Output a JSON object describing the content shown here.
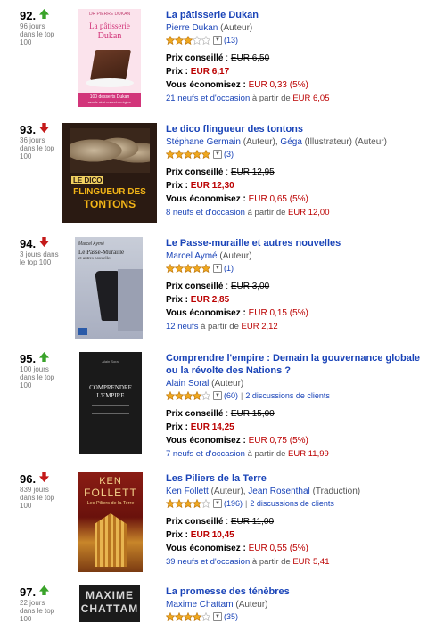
{
  "labels": {
    "list_price": "Prix conseillé",
    "price": "Prix :",
    "you_save": "Vous économisez :",
    "from": "à partir de"
  },
  "colors": {
    "link": "#1a44b8",
    "price": "#bb0000",
    "arrow_up": "#3aa32a",
    "arrow_down": "#c41a1a"
  },
  "items": [
    {
      "rank": "92.",
      "trend": "up",
      "days": "96 jours dans le top 100",
      "cover": {
        "text_top": "DR PIERRE DUKAN",
        "title_line1": "La pâtisserie",
        "title_line2": "Dukan",
        "footer_line1": "100 desserts Dukan",
        "footer_line2": "avec le strict respect du régime"
      },
      "title": "La pâtisserie Dukan",
      "authors": "Pierre Dukan",
      "roles": "(Auteur)",
      "rating_count": "(13)",
      "discussions": "",
      "stars": 3,
      "list_price": "EUR 6,50",
      "price": "EUR 6,17",
      "savings": "EUR 0,33 (5%)",
      "offers_count": "21 neufs et d'occasion",
      "offers_from": "EUR 6,05"
    },
    {
      "rank": "93.",
      "trend": "down",
      "days": "36 jours dans le top 100",
      "cover": {
        "text_top": "",
        "title_line1": "LE DICO",
        "title_line2": "FLINGUEUR DES",
        "title_line3": "TONTONS"
      },
      "title": "Le dico flingueur des tontons",
      "authors": "Stéphane Germain",
      "roles": "(Auteur),",
      "authors2": "Géga",
      "roles2": "(Illustrateur) (Auteur)",
      "rating_count": "(3)",
      "discussions": "",
      "stars": 5,
      "list_price": "EUR 12,95",
      "price": "EUR 12,30",
      "savings": "EUR 0,65 (5%)",
      "offers_count": "8 neufs et d'occasion",
      "offers_from": "EUR 12,00"
    },
    {
      "rank": "94.",
      "trend": "down",
      "days": "3 jours dans le top 100",
      "cover": {
        "text_top": "Marcel Aymé",
        "title_line1": "Le Passe-Muraille",
        "title_line2": "et autres nouvelles"
      },
      "title": "Le Passe-muraille et autres nouvelles",
      "authors": "Marcel Aymé",
      "roles": "(Auteur)",
      "rating_count": "(1)",
      "discussions": "",
      "stars": 5,
      "list_price": "EUR 3,00",
      "price": "EUR 2,85",
      "savings": "EUR 0,15 (5%)",
      "offers_count": "12 neufs",
      "offers_from": "EUR 2,12"
    },
    {
      "rank": "95.",
      "trend": "up",
      "days": "100 jours dans le top 100",
      "cover": {
        "text_top": "Alain Soral",
        "title_line1": "COMPRENDRE",
        "title_line2": "L'EMPIRE"
      },
      "title": "Comprendre l'empire : Demain la gouvernance globale ou la révolte des Nations ?",
      "authors": "Alain Soral",
      "roles": "(Auteur)",
      "rating_count": "(60)",
      "discussions": "2 discussions de clients",
      "stars": 4,
      "list_price": "EUR 15,00",
      "price": "EUR 14,25",
      "savings": "EUR 0,75 (5%)",
      "offers_count": "7 neufs et d'occasion",
      "offers_from": "EUR 11,99"
    },
    {
      "rank": "96.",
      "trend": "down",
      "days": "839 jours dans le top 100",
      "cover": {
        "text_top": "",
        "title_line1": "KEN",
        "title_line2": "FOLLETT",
        "title_line3": "Les Piliers de la Terre"
      },
      "title": "Les Piliers de la Terre",
      "authors": "Ken Follett",
      "roles": "(Auteur),",
      "authors2": "Jean Rosenthal",
      "roles2": "(Traduction)",
      "rating_count": "(196)",
      "discussions": "2 discussions de clients",
      "stars": 4,
      "list_price": "EUR 11,00",
      "price": "EUR 10,45",
      "savings": "EUR 0,55 (5%)",
      "offers_count": "39 neufs et d'occasion",
      "offers_from": "EUR 5,41"
    },
    {
      "rank": "97.",
      "trend": "up",
      "days": "22 jours dans le top 100",
      "cover": {
        "text_top": "",
        "title_line1": "MAXIME",
        "title_line2": "CHATTAM"
      },
      "title": "La promesse des ténèbres",
      "authors": "Maxime Chattam",
      "roles": "(Auteur)",
      "rating_count": "(35)",
      "discussions": "",
      "stars": 4
    }
  ]
}
